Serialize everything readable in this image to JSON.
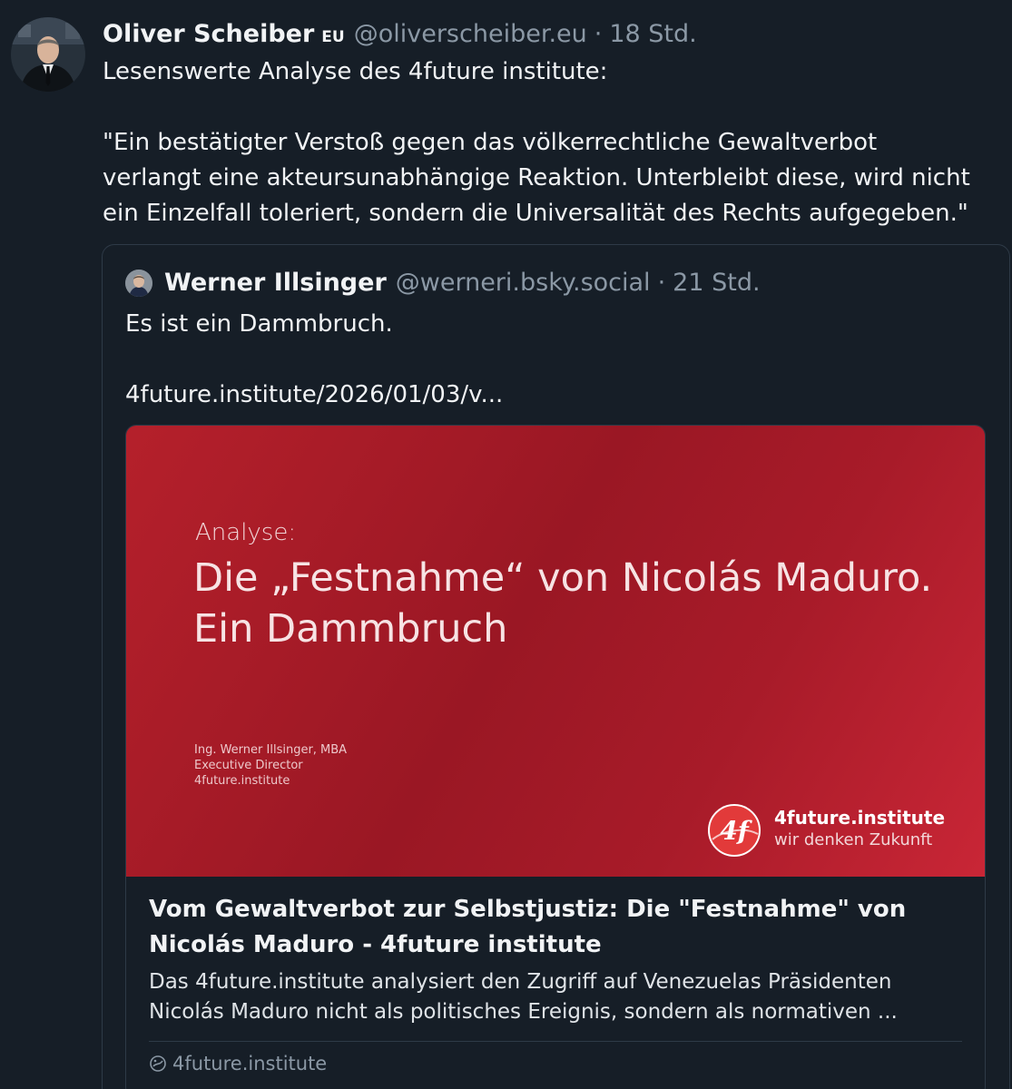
{
  "post": {
    "author_name": "Oliver Scheiber",
    "badge": "EU",
    "handle": "@oliverscheiber.eu",
    "separator": "·",
    "time": "18 Std.",
    "text_line1": "Lesenswerte Analyse des 4future institute:",
    "text_line2": "\"Ein bestätigter Verstoß gegen das völkerrechtliche Gewaltverbot",
    "text_line3": "verlangt eine akteursunabhängige Reaktion. Unterbleibt diese, wird nicht",
    "text_line4": "ein Einzelfall toleriert, sondern die Universalität des Rechts aufgegeben.\""
  },
  "quote": {
    "author_name": "Werner Illsinger",
    "handle": "@werneri.bsky.social",
    "separator": "·",
    "time": "21 Std.",
    "text_line1": "Es ist ein Dammbruch.",
    "text_line2": "4future.institute/2026/01/03/v..."
  },
  "link_card": {
    "thumbnail": {
      "kicker": "Analyse:",
      "headline_line1": "Die „Festnahme“ von Nicolás Maduro.",
      "headline_line2": "Ein Dammbruch",
      "credit_line1": "Ing. Werner Illsinger, MBA",
      "credit_line2": "Executive Director",
      "credit_line3": "4future.institute",
      "logo_text": "4f",
      "brand": "4future.institute",
      "tagline": "wir denken Zukunft",
      "colors": {
        "primary": "#b5202b",
        "dark": "#9a1724"
      }
    },
    "title_line1": "Vom Gewaltverbot zur Selbstjustiz: Die \"Festnahme\" von",
    "title_line2": "Nicolás Maduro - 4future institute",
    "desc_line1": "Das 4future.institute analysiert den Zugriff auf Venezuelas Präsidenten",
    "desc_line2": "Nicolás Maduro nicht als politisches Ereignis, sondern als normativen ...",
    "domain_icon": "globe-icon",
    "domain": "4future.institute"
  },
  "colors": {
    "background": "#161e27",
    "text": "#f1f3f5",
    "muted": "#8b98a5",
    "border": "#2e3a47"
  }
}
